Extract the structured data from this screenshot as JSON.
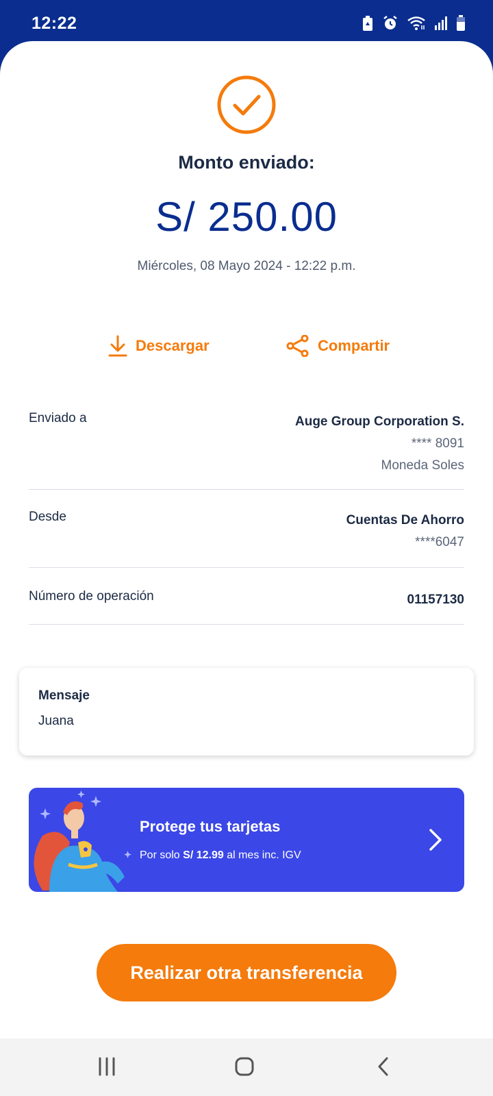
{
  "status_bar": {
    "time": "12:22",
    "icons": [
      "battery-saver-icon",
      "alarm-icon",
      "wifi-icon",
      "signal-icon",
      "battery-icon"
    ]
  },
  "receipt": {
    "status_icon": "check-circle-icon",
    "amount_label": "Monto enviado:",
    "amount": "S/ 250.00",
    "datetime": "Miércoles, 08 Mayo 2024 - 12:22 p.m."
  },
  "actions": {
    "download": {
      "label": "Descargar",
      "icon": "download-icon"
    },
    "share": {
      "label": "Compartir",
      "icon": "share-icon"
    }
  },
  "details": {
    "sent_to": {
      "label": "Enviado a",
      "name": "Auge Group Corporation S.",
      "account": "**** 8091",
      "currency": "Moneda Soles"
    },
    "from": {
      "label": "Desde",
      "account_type": "Cuentas De Ahorro",
      "account": "****6047"
    },
    "operation": {
      "label": "Número de operación",
      "number": "01157130"
    }
  },
  "message": {
    "title": "Mensaje",
    "text": "Juana"
  },
  "promo": {
    "title": "Protege tus tarjetas",
    "subtitle_prefix": "Por solo ",
    "price": "S/ 12.99",
    "subtitle_suffix": " al mes inc. IGV"
  },
  "cta": {
    "label": "Realizar otra transferencia"
  },
  "nav": {
    "icons": [
      "recents-icon",
      "home-icon",
      "back-icon"
    ]
  },
  "colors": {
    "brand_blue": "#0a2d8f",
    "accent_orange": "#f47b0c",
    "promo_blue": "#3b47e6"
  }
}
